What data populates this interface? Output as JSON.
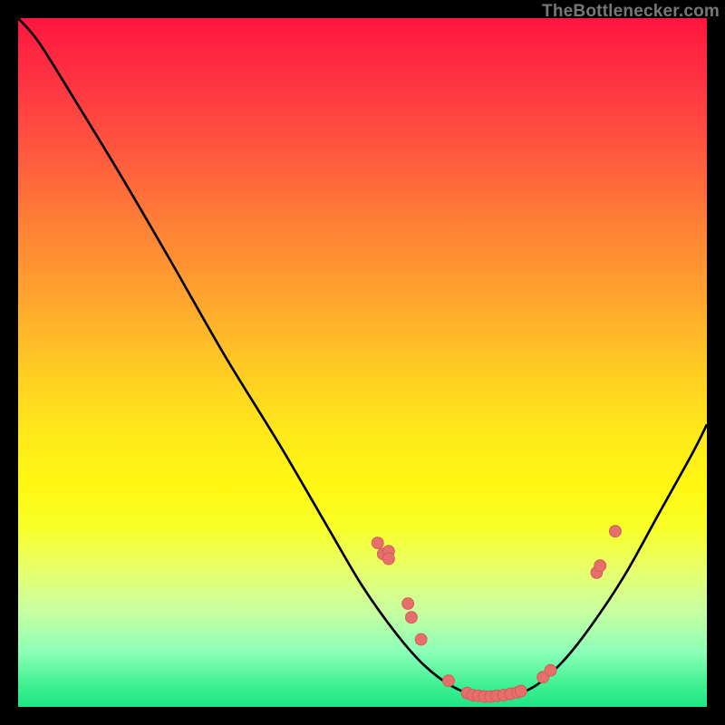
{
  "watermark": "TheBottlenecker.com",
  "colors": {
    "curve": "#000000",
    "marker": "#e66f6c",
    "marker_stroke": "#d15b58",
    "background": "#000000"
  },
  "chart_data": {
    "type": "line",
    "title": "",
    "xlabel": "",
    "ylabel": "",
    "xlim": [
      0,
      100
    ],
    "ylim": [
      0,
      100
    ],
    "curve": [
      {
        "x": 0.0,
        "y": 100.0
      },
      {
        "x": 3.0,
        "y": 96.5
      },
      {
        "x": 8.0,
        "y": 88.5
      },
      {
        "x": 15.0,
        "y": 77.0
      },
      {
        "x": 22.0,
        "y": 65.0
      },
      {
        "x": 30.0,
        "y": 51.0
      },
      {
        "x": 38.0,
        "y": 38.0
      },
      {
        "x": 45.0,
        "y": 26.0
      },
      {
        "x": 50.0,
        "y": 17.5
      },
      {
        "x": 55.0,
        "y": 10.5
      },
      {
        "x": 59.0,
        "y": 6.0
      },
      {
        "x": 63.0,
        "y": 3.0
      },
      {
        "x": 67.0,
        "y": 1.5
      },
      {
        "x": 71.0,
        "y": 1.5
      },
      {
        "x": 75.0,
        "y": 3.0
      },
      {
        "x": 79.0,
        "y": 6.5
      },
      {
        "x": 83.0,
        "y": 11.5
      },
      {
        "x": 88.0,
        "y": 19.0
      },
      {
        "x": 93.0,
        "y": 28.0
      },
      {
        "x": 98.0,
        "y": 37.0
      },
      {
        "x": 100.0,
        "y": 41.0
      }
    ],
    "markers": [
      {
        "x": 52.2,
        "y": 23.8
      },
      {
        "x": 53.0,
        "y": 22.2
      },
      {
        "x": 53.8,
        "y": 22.6
      },
      {
        "x": 53.8,
        "y": 21.5
      },
      {
        "x": 56.6,
        "y": 15.0
      },
      {
        "x": 57.1,
        "y": 13.0
      },
      {
        "x": 58.5,
        "y": 9.8
      },
      {
        "x": 62.5,
        "y": 3.8
      },
      {
        "x": 65.2,
        "y": 2.0
      },
      {
        "x": 66.0,
        "y": 1.7
      },
      {
        "x": 66.8,
        "y": 1.6
      },
      {
        "x": 67.7,
        "y": 1.5
      },
      {
        "x": 68.6,
        "y": 1.5
      },
      {
        "x": 69.5,
        "y": 1.6
      },
      {
        "x": 70.5,
        "y": 1.7
      },
      {
        "x": 71.5,
        "y": 1.9
      },
      {
        "x": 72.5,
        "y": 2.1
      },
      {
        "x": 73.0,
        "y": 2.3
      },
      {
        "x": 76.2,
        "y": 4.3
      },
      {
        "x": 77.3,
        "y": 5.3
      },
      {
        "x": 84.0,
        "y": 19.5
      },
      {
        "x": 84.5,
        "y": 20.5
      },
      {
        "x": 86.7,
        "y": 25.5
      }
    ]
  }
}
